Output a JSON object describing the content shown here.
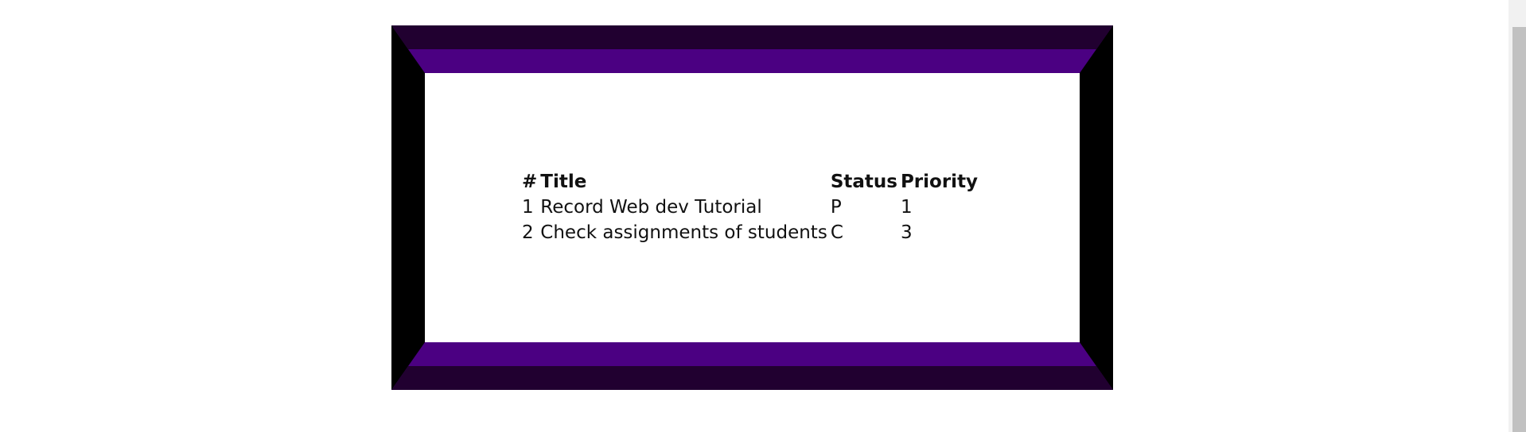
{
  "colors": {
    "frame_band": "#4b0082",
    "frame_band_dark": "#210030",
    "frame_side": "#000000",
    "background": "#ffffff",
    "scrollbar_thumb": "#c1c1c1"
  },
  "table": {
    "headers": {
      "number": "#",
      "title": "Title",
      "status": "Status",
      "priority": "Priority"
    },
    "rows": [
      {
        "number": "1",
        "title": "Record Web dev Tutorial",
        "status": "P",
        "priority": "1"
      },
      {
        "number": "2",
        "title": "Check assignments of students",
        "status": "C",
        "priority": "3"
      }
    ]
  }
}
